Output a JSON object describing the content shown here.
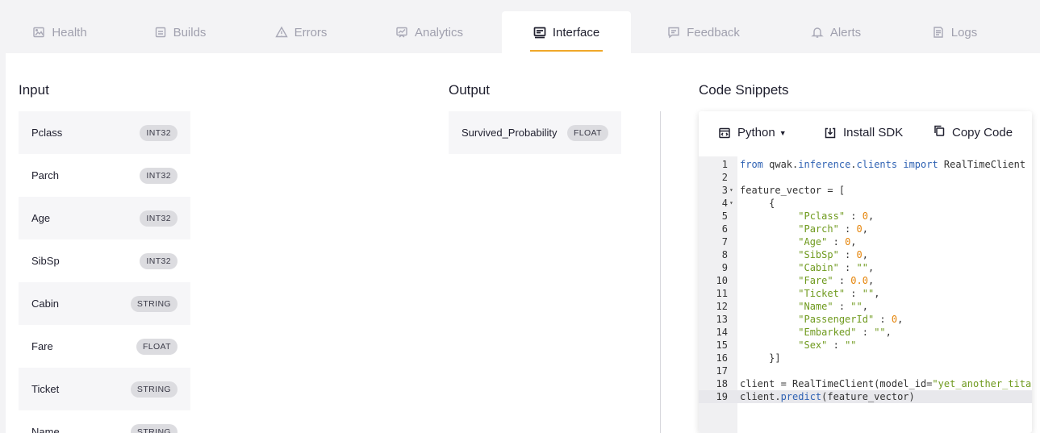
{
  "tabs": [
    {
      "label": "Health",
      "icon": "image-icon",
      "active": false
    },
    {
      "label": "Builds",
      "icon": "list-box-icon",
      "active": false
    },
    {
      "label": "Errors",
      "icon": "warning-icon",
      "active": false
    },
    {
      "label": "Analytics",
      "icon": "chart-icon",
      "active": false
    },
    {
      "label": "Interface",
      "icon": "interface-icon",
      "active": true
    },
    {
      "label": "Feedback",
      "icon": "feedback-icon",
      "active": false
    },
    {
      "label": "Alerts",
      "icon": "bell-icon",
      "active": false
    },
    {
      "label": "Logs",
      "icon": "log-icon",
      "active": false
    }
  ],
  "accent_color": "#f0a82a",
  "input": {
    "title": "Input",
    "fields": [
      {
        "name": "Pclass",
        "type": "INT32"
      },
      {
        "name": "Parch",
        "type": "INT32"
      },
      {
        "name": "Age",
        "type": "INT32"
      },
      {
        "name": "SibSp",
        "type": "INT32"
      },
      {
        "name": "Cabin",
        "type": "STRING"
      },
      {
        "name": "Fare",
        "type": "FLOAT"
      },
      {
        "name": "Ticket",
        "type": "STRING"
      },
      {
        "name": "Name",
        "type": "STRING"
      }
    ]
  },
  "output": {
    "title": "Output",
    "fields": [
      {
        "name": "Survived_Probability",
        "type": "FLOAT"
      }
    ]
  },
  "code_snippets": {
    "title": "Code Snippets",
    "language": "Python",
    "install_label": "Install SDK",
    "copy_label": "Copy Code",
    "highlighted_line": 19,
    "lines": [
      {
        "n": "1",
        "fold": "",
        "code": "from qwak.inference.clients import RealTimeClient"
      },
      {
        "n": "2",
        "fold": "",
        "code": ""
      },
      {
        "n": "3",
        "fold": "▾",
        "code": "feature_vector = ["
      },
      {
        "n": "4",
        "fold": "▾",
        "code": "     {"
      },
      {
        "n": "5",
        "fold": "",
        "code": "          \"Pclass\" : 0,"
      },
      {
        "n": "6",
        "fold": "",
        "code": "          \"Parch\" : 0,"
      },
      {
        "n": "7",
        "fold": "",
        "code": "          \"Age\" : 0,"
      },
      {
        "n": "8",
        "fold": "",
        "code": "          \"SibSp\" : 0,"
      },
      {
        "n": "9",
        "fold": "",
        "code": "          \"Cabin\" : \"\","
      },
      {
        "n": "10",
        "fold": "",
        "code": "          \"Fare\" : 0.0,"
      },
      {
        "n": "11",
        "fold": "",
        "code": "          \"Ticket\" : \"\","
      },
      {
        "n": "12",
        "fold": "",
        "code": "          \"Name\" : \"\","
      },
      {
        "n": "13",
        "fold": "",
        "code": "          \"PassengerId\" : 0,"
      },
      {
        "n": "14",
        "fold": "",
        "code": "          \"Embarked\" : \"\","
      },
      {
        "n": "15",
        "fold": "",
        "code": "          \"Sex\" : \"\""
      },
      {
        "n": "16",
        "fold": "",
        "code": "     }]"
      },
      {
        "n": "17",
        "fold": "",
        "code": ""
      },
      {
        "n": "18",
        "fold": "",
        "code": "client = RealTimeClient(model_id=\"yet_another_titan"
      },
      {
        "n": "19",
        "fold": "",
        "code": "client.predict(feature_vector)"
      }
    ]
  }
}
